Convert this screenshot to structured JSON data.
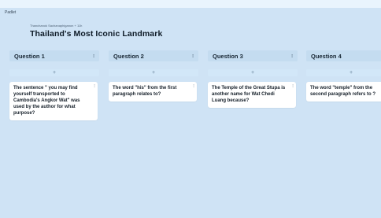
{
  "app": {
    "brand": "Padlet"
  },
  "board": {
    "subtitle": "Thanchanok Sachanaphiganon + 11h",
    "title": "Thailand's Most Iconic Landmark"
  },
  "ui": {
    "add_symbol": "+",
    "menu_symbol": "⁝",
    "card_menu_symbol": "⁝"
  },
  "columns": [
    {
      "title": "Question 1",
      "cards": [
        "The sentence \" you may find yourself transported to Cambodia's Angkor Wat\" was used by the author for what purpose?"
      ]
    },
    {
      "title": "Question 2",
      "cards": [
        "The word \"his\" from the first paragraph relates to?"
      ]
    },
    {
      "title": "Question 3",
      "cards": [
        "The Temple of the Great Stupa is another name for Wat Chedi Luang because?"
      ]
    },
    {
      "title": "Question 4",
      "cards": [
        "The word \"temple\" from the second paragraph refers to ?"
      ]
    }
  ]
}
